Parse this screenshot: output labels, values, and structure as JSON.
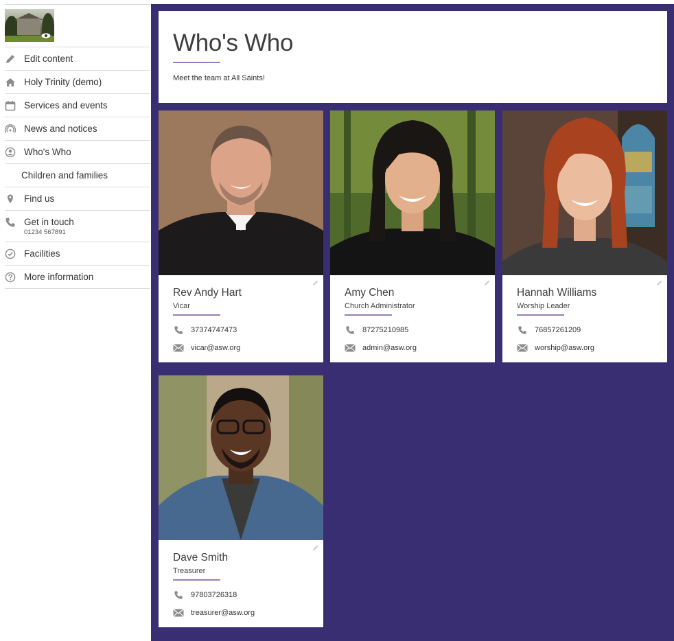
{
  "sidebar": {
    "logo_alt": "church-photo",
    "items": [
      {
        "icon": "pencil-icon",
        "label": "Edit content"
      },
      {
        "icon": "home-icon",
        "label": "Holy Trinity (demo)"
      },
      {
        "icon": "calendar-icon",
        "label": "Services and events"
      },
      {
        "icon": "broadcast-icon",
        "label": "News and notices"
      },
      {
        "icon": "person-circle-icon",
        "label": "Who's Who"
      },
      {
        "icon": "",
        "label": "Children and families"
      },
      {
        "icon": "map-pin-icon",
        "label": "Find us"
      },
      {
        "icon": "phone-icon",
        "label": "Get in touch",
        "sub": "01234 567891"
      },
      {
        "icon": "check-circle-icon",
        "label": "Facilities"
      },
      {
        "icon": "question-circle-icon",
        "label": "More information"
      }
    ]
  },
  "header": {
    "title": "Who's Who",
    "intro": "Meet the team at All Saints!"
  },
  "people": [
    {
      "name": "Rev Andy Hart",
      "role": "Vicar",
      "phone": "37374747473",
      "email": "vicar@asw.org"
    },
    {
      "name": "Amy Chen",
      "role": "Church Administrator",
      "phone": "87275210985",
      "email": "admin@asw.org"
    },
    {
      "name": "Hannah Williams",
      "role": "Worship Leader",
      "phone": "76857261209",
      "email": "worship@asw.org"
    },
    {
      "name": "Dave Smith",
      "role": "Treasurer",
      "phone": "97803726318",
      "email": "treasurer@asw.org"
    }
  ],
  "colors": {
    "accent_purple": "#3a2e73",
    "rule_lilac": "#9b7cb6",
    "icon_grey": "#8c8c8c"
  }
}
